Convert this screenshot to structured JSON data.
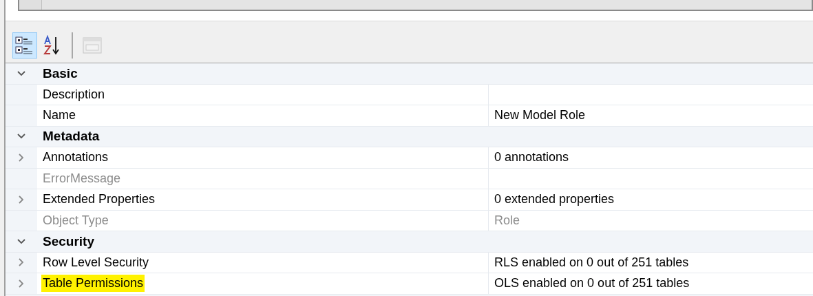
{
  "toolbar": {
    "buttons": [
      {
        "kind": "categorized",
        "selected": true,
        "disabled": false
      },
      {
        "kind": "alphabetical",
        "selected": false,
        "disabled": false
      },
      {
        "kind": "property-pages",
        "selected": false,
        "disabled": true
      }
    ]
  },
  "categories": [
    {
      "name": "Basic",
      "expanded": true,
      "properties": [
        {
          "name": "Description",
          "expandable": false,
          "readonly": false,
          "highlighted": false
        },
        {
          "name": "Name",
          "value": "New Model Role",
          "expandable": false,
          "readonly": false,
          "highlighted": false
        }
      ]
    },
    {
      "name": "Metadata",
      "expanded": true,
      "properties": [
        {
          "name": "Annotations",
          "value": "0 annotations",
          "expandable": true,
          "readonly": false,
          "highlighted": false
        },
        {
          "name": "ErrorMessage",
          "expandable": false,
          "readonly": true,
          "highlighted": false
        },
        {
          "name": "Extended Properties",
          "value": "0 extended properties",
          "expandable": true,
          "readonly": false,
          "highlighted": false
        },
        {
          "name": "Object Type",
          "value": "Role",
          "expandable": false,
          "readonly": true,
          "highlighted": false
        }
      ]
    },
    {
      "name": "Security",
      "expanded": true,
      "properties": [
        {
          "name": "Row Level Security",
          "value": "RLS enabled on 0 out of 251 tables",
          "expandable": true,
          "readonly": false,
          "highlighted": false
        },
        {
          "name": "Table Permissions",
          "value": "OLS enabled on 0 out of 251 tables",
          "expandable": true,
          "readonly": false,
          "highlighted": true
        }
      ]
    }
  ]
}
